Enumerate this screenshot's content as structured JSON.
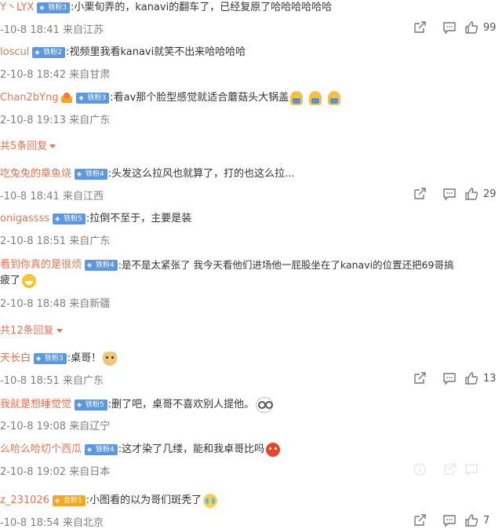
{
  "comments": [
    {
      "name": "Y丶LYX",
      "badge": "铁粉3",
      "text": ":小栗旬弄的，kanavi的翻车了，已经复原了哈哈哈哈哈哈",
      "time": "-10-8 18:41",
      "location": "来自江苏",
      "likes": "99"
    },
    {
      "name": "loscul",
      "badge": "铁粉2",
      "text": ":视频里我看kanavi就笑不出来哈哈哈哈",
      "time": "2-10-8 18:42",
      "location": "来自甘肃"
    },
    {
      "name": "Chan2bYng",
      "badge": "铁粉3",
      "text": ":看av那个脸型感觉就适合蘑菇头大锅盖",
      "time": "2-10-8 19:13",
      "location": "来自广东"
    },
    {
      "name": "吃兔兔的章鱼烧",
      "badge": "铁粉4",
      "text": ":头发这么拉风也就算了，打的也这么拉...",
      "time": "-10-8 18:41",
      "location": "来自江西",
      "likes": "29"
    },
    {
      "name": "onigassss",
      "badge": "铁粉5",
      "text": ":拉倒不至于，主要是装",
      "time": "2-10-8 18:51",
      "location": "来自广东"
    },
    {
      "name": "看到你真的是很烦",
      "badge": "铁粉4",
      "text": ":是不是太紧张了 我今天看他们进场他一屁股坐在了kanavi的位置还把69哥搞",
      "text2": "疲了",
      "time": "2-10-8 18:48",
      "location": "来自新疆"
    },
    {
      "name": "天长白",
      "badge": "铁粉3",
      "text": ":桌哥！",
      "time": "-10-8 18:51",
      "location": "来自广东",
      "likes": "13"
    },
    {
      "name": "我就是想睡觉觉",
      "badge": "铁粉5",
      "text": ":删了吧，桌哥不喜欢别人提他。",
      "time": "2-10-8 19:08",
      "location": "来自辽宁"
    },
    {
      "name": "么哈么哈切个西瓜",
      "badge": "铁粉4",
      "text": ":这才染了几缕，能和我卓哥比吗",
      "time": "2-10-8 19:02",
      "location": "来自日本"
    },
    {
      "name": "z_231026",
      "badge": "金粉1",
      "text": ":小图看的以为哥们斑秃了",
      "time": "-10-8 18:54",
      "location": "来自北京",
      "likes": "7"
    }
  ],
  "replies": [
    "共5条回复",
    "共12条回复"
  ],
  "icons": {
    "share": "share-icon",
    "comment": "comment-icon",
    "like": "like-icon"
  },
  "colors": {
    "name": "#eb7350",
    "badge": "#5d97e0",
    "meta": "#808080"
  }
}
